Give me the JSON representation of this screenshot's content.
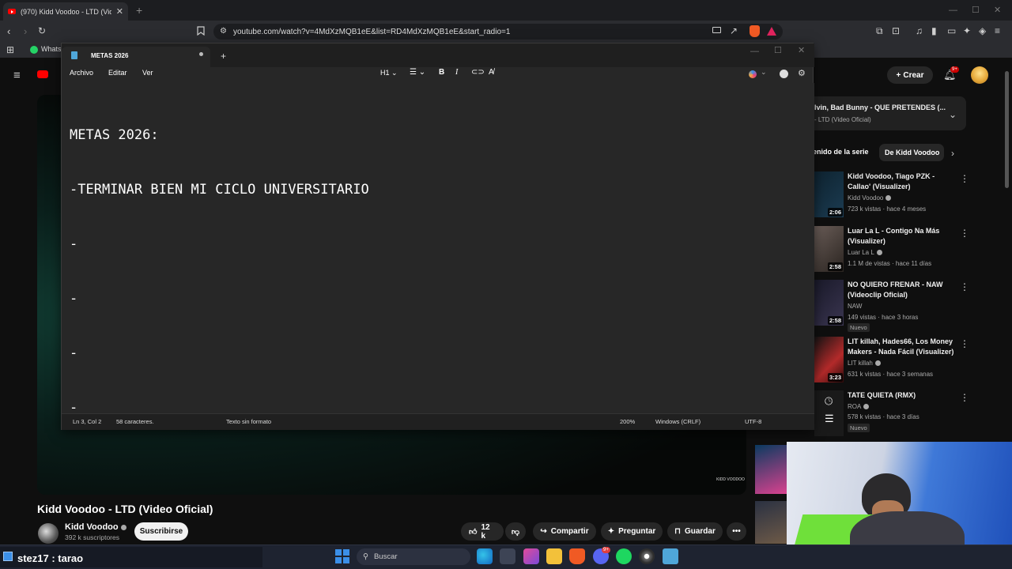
{
  "browser": {
    "tab_title": "(970) Kidd Voodoo - LTD (Video",
    "url": "youtube.com/watch?v=4MdXzMQB1eE&list=RD4MdXzMQB1eE&start_radio=1",
    "bookmark_label": "Whats"
  },
  "youtube": {
    "video_title": "Kidd Voodoo - LTD (Video Oficial)",
    "channel_name": "Kidd Voodoo",
    "subscribers": "392 k suscriptores",
    "subscribe_label": "Suscribirse",
    "likes": "12 k",
    "share_label": "Compartir",
    "ask_label": "Preguntar",
    "save_label": "Guardar",
    "create_label": "Crear",
    "notif_badge": "9+",
    "watermark": "KIDD VOODOO",
    "playlist_title": "lvin, Bad Bunny - QUE PRETENDES (...",
    "playlist_sub": "- LTD (Video Oficial)",
    "chip_1": "enido de la serie",
    "chip_2": "De Kidd Voodoo",
    "recommendations": [
      {
        "title_1": "Kidd Voodoo, Tiago PZK -",
        "title_2": "Callao' (Visualizer)",
        "channel": "Kidd Voodoo",
        "meta": "723 k vistas · hace 4 meses",
        "duration": "2:06",
        "badge": ""
      },
      {
        "title_1": "Luar La L - Contigo Na Más",
        "title_2": "(Visualizer)",
        "channel": "Luar La L",
        "meta": "1.1 M de vistas · hace 11 días",
        "duration": "2:58",
        "badge": ""
      },
      {
        "title_1": "NO QUIERO FRENAR - NAW",
        "title_2": "(Videoclip Oficial)",
        "channel": "NAW",
        "meta": "149 vistas · hace 3 horas",
        "duration": "2:58",
        "badge": "Nuevo"
      },
      {
        "title_1": "LIT killah, Hades66, Los Money",
        "title_2": "Makers - Nada Fácil (Visualizer)",
        "channel": "LIT killah",
        "meta": "631 k vistas · hace 3 semanas",
        "duration": "3:23",
        "badge": ""
      },
      {
        "title_1": "TATE QUIETA (RMX)",
        "title_2": "",
        "channel": "ROA",
        "meta": "578 k vistas · hace 3 días",
        "duration": "",
        "badge": "Nuevo"
      }
    ]
  },
  "notepad": {
    "tab_name": "METAS 2026",
    "menu": [
      "Archivo",
      "Editar",
      "Ver"
    ],
    "heading_label": "H1",
    "lines": [
      "METAS 2026:",
      "-TERMINAR BIEN MI CICLO UNIVERSITARIO",
      "-",
      "-",
      "-",
      "-"
    ],
    "status": {
      "position": "Ln 3, Col 2",
      "chars": "58 caracteres.",
      "format": "Texto sin formato",
      "zoom": "200%",
      "line_ending": "Windows (CRLF)",
      "encoding": "UTF-8"
    }
  },
  "taskbar": {
    "chat_text": "stez17 : tarao",
    "search_placeholder": "Buscar",
    "discord_badge": "9+"
  },
  "colors": {
    "youtube_red": "#ff0000",
    "notepad_bg": "#272727",
    "taskbar_bg": "#1e2330",
    "windows_blue": "#3b8fe8"
  }
}
